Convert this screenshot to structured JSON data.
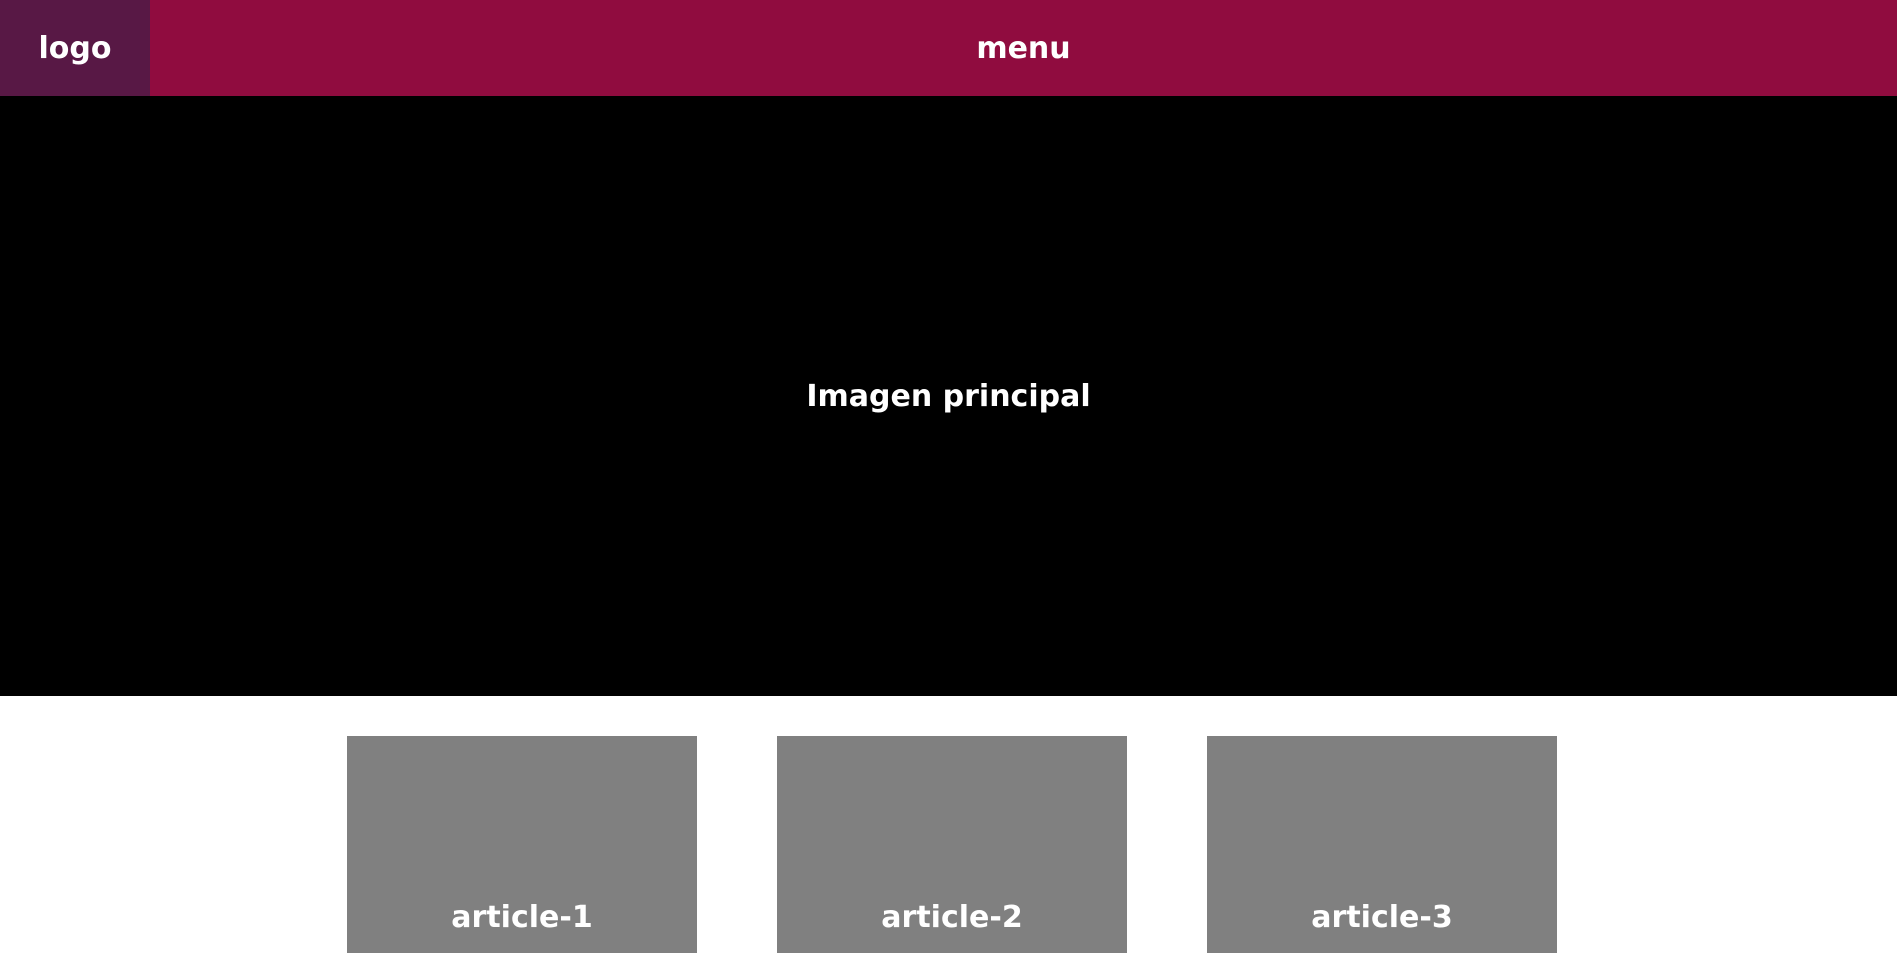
{
  "header": {
    "logo_label": "logo",
    "menu_label": "menu"
  },
  "hero": {
    "label": "Imagen principal"
  },
  "articles": [
    {
      "label": "article-1"
    },
    {
      "label": "article-2"
    },
    {
      "label": "article-3"
    }
  ],
  "colors": {
    "logo_bg": "#581845",
    "menu_bg": "#900C3F",
    "hero_bg": "#000000",
    "article_bg": "#808080",
    "text": "#FFFFFF"
  }
}
